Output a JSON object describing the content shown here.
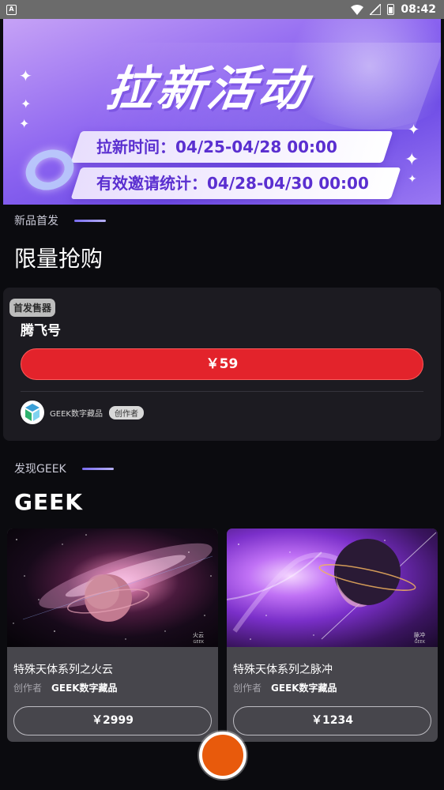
{
  "status_bar": {
    "notification_icon": "A",
    "time": "08:42",
    "icons": [
      "wifi-icon",
      "signal-icon",
      "battery-icon"
    ]
  },
  "banner": {
    "title": "拉新活动",
    "line1": "拉新时间：04/25-04/28 00:00",
    "line2": "有效邀请统计：04/28-04/30 00:00"
  },
  "section_new": {
    "tag": "新品首发",
    "title": "限量抢购",
    "product": {
      "badge": "首发售器",
      "name": "腾飞号",
      "price": "￥59",
      "creator_name": "GEEK数字藏品",
      "creator_badge": "创作者"
    }
  },
  "section_discover": {
    "tag": "发现GEEK",
    "title": "GEEK",
    "items": [
      {
        "image_caption": "火云",
        "image_brand": "GEEK",
        "title": "特殊天体系列之火云",
        "creator_label": "创作者",
        "creator_name": "GEEK数字藏品",
        "price": "￥2999"
      },
      {
        "image_caption": "脉冲",
        "image_brand": "GEEK",
        "title": "特殊天体系列之脉冲",
        "creator_label": "创作者",
        "creator_name": "GEEK数字藏品",
        "price": "￥1234"
      }
    ]
  },
  "colors": {
    "background": "#0b0b0f",
    "card": "#1c1b21",
    "price_button": "#e3232b",
    "fab": "#e85a0c"
  }
}
